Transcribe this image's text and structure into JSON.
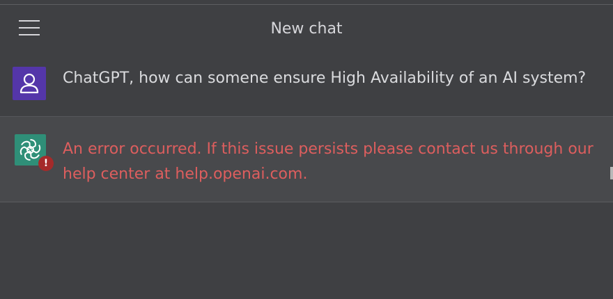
{
  "header": {
    "title": "New chat",
    "menu_icon": "hamburger-menu-icon"
  },
  "conversation": {
    "user_message": "ChatGPT, how can somene ensure High Availability of an AI system?",
    "assistant_error": "An error occurred. If this issue persists please contact us through our help center at help.openai.com.",
    "error_badge": "!"
  },
  "colors": {
    "background": "#3f4043",
    "assistant_row": "#48494c",
    "user_avatar": "#5436a9",
    "assistant_avatar": "#2f8f78",
    "error_text": "#dd5e5e",
    "error_badge": "#a52a2a"
  }
}
